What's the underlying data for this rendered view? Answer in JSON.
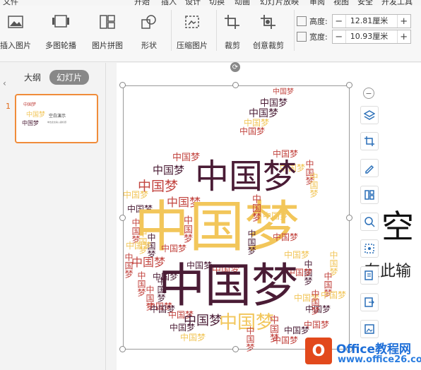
{
  "menu": [
    "文件",
    "开始",
    "插入",
    "设计",
    "切换",
    "动画",
    "幻灯片放映",
    "审阅",
    "视图",
    "安全",
    "开发工具"
  ],
  "ribbon": {
    "insert_picture": "插入图片",
    "multi_carousel": "多图轮播",
    "picture_collage": "图片拼图",
    "shape": "形状",
    "compress": "压缩图片",
    "crop": "裁剪",
    "creative_crop": "创意裁剪",
    "height_label": "高度:",
    "height_value": "12.81厘米",
    "width_label": "宽度:",
    "width_value": "10.93厘米",
    "minus": "−",
    "plus": "+"
  },
  "left_panel": {
    "collapse": "‹",
    "tab_outline": "大纲",
    "tab_slides": "幻灯片",
    "slide_number": "1",
    "thumb_title": "空白演示",
    "thumb_subtitle": "单击此处输入副标题",
    "thumb_word": "中国梦"
  },
  "canvas": {
    "title_partial": "空",
    "subtitle_partial": "在此输",
    "wordcloud_word": "中国梦",
    "rotate": "⟳"
  },
  "colors": {
    "yellow": "#f2c65a",
    "dark": "#4a1c35",
    "red": "#c2443f",
    "accent": "#f08c3a"
  },
  "watermark": {
    "brand": "Office教程网",
    "url": "www.office26.com"
  }
}
